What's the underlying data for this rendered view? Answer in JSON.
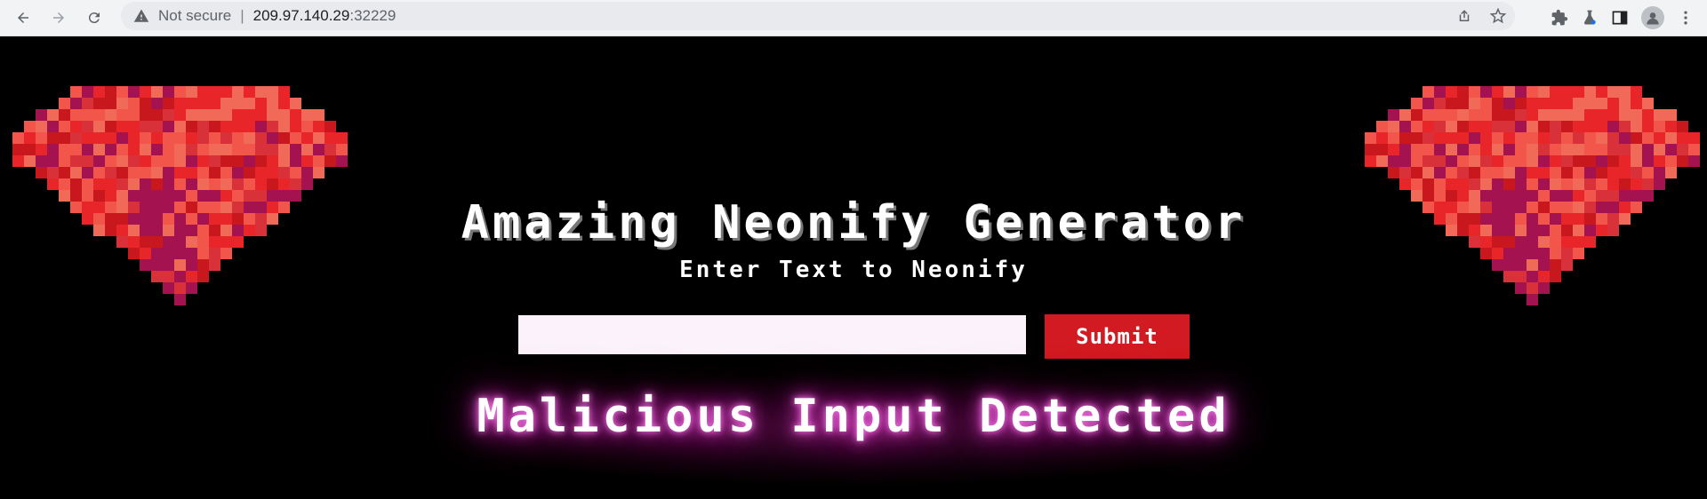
{
  "browser": {
    "security_label": "Not secure",
    "url_host": "209.97.140.29",
    "url_port": ":32229"
  },
  "page": {
    "title": "Amazing Neonify Generator",
    "subtitle": "Enter Text to Neonify",
    "input": {
      "value": "",
      "placeholder": ""
    },
    "submit_label": "Submit",
    "result_text": "Malicious Input Detected"
  },
  "colors": {
    "accent": "#d11a21",
    "neon_glow": "#e84dd6",
    "background": "#000000"
  }
}
